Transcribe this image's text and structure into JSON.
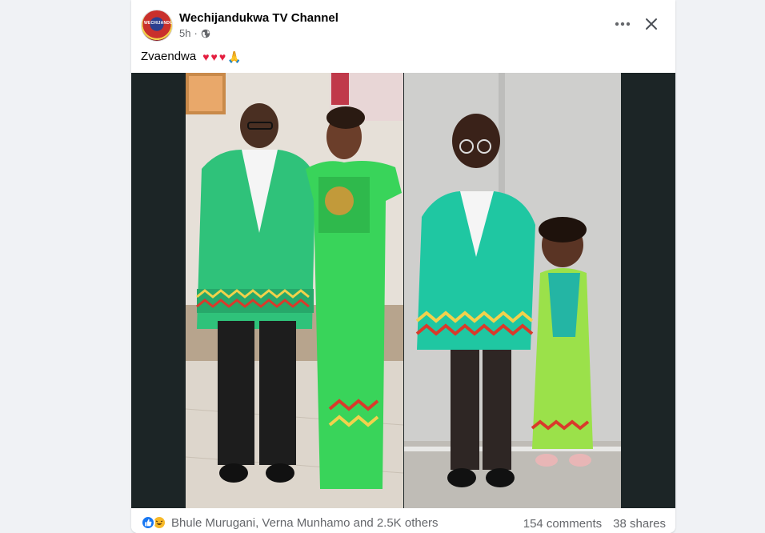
{
  "post": {
    "page_name": "Wechijandukwa TV Channel",
    "avatar_text": "WECHIJANDUKWA",
    "time": "5h",
    "separator": "·",
    "privacy_icon": "globe-icon",
    "caption": {
      "text": "Zvaendwa",
      "emojis": [
        "♥",
        "♥",
        "♥",
        "🙏"
      ]
    }
  },
  "photo": {
    "description_icon": "photo-collage"
  },
  "footer": {
    "reaction_icons": [
      "like-icon",
      "haha-icon"
    ],
    "reaction_summary": "Bhule Murugani, Verna Munhamo and 2.5K others",
    "comments": "154 comments",
    "shares": "38 shares"
  },
  "colors": {
    "background": "#f0f2f5",
    "card": "#ffffff",
    "text_primary": "#050505",
    "text_secondary": "#65676b",
    "like_blue": "#1877f2",
    "heart_red": "#e41e3f",
    "photo_border": "#1c2526"
  }
}
